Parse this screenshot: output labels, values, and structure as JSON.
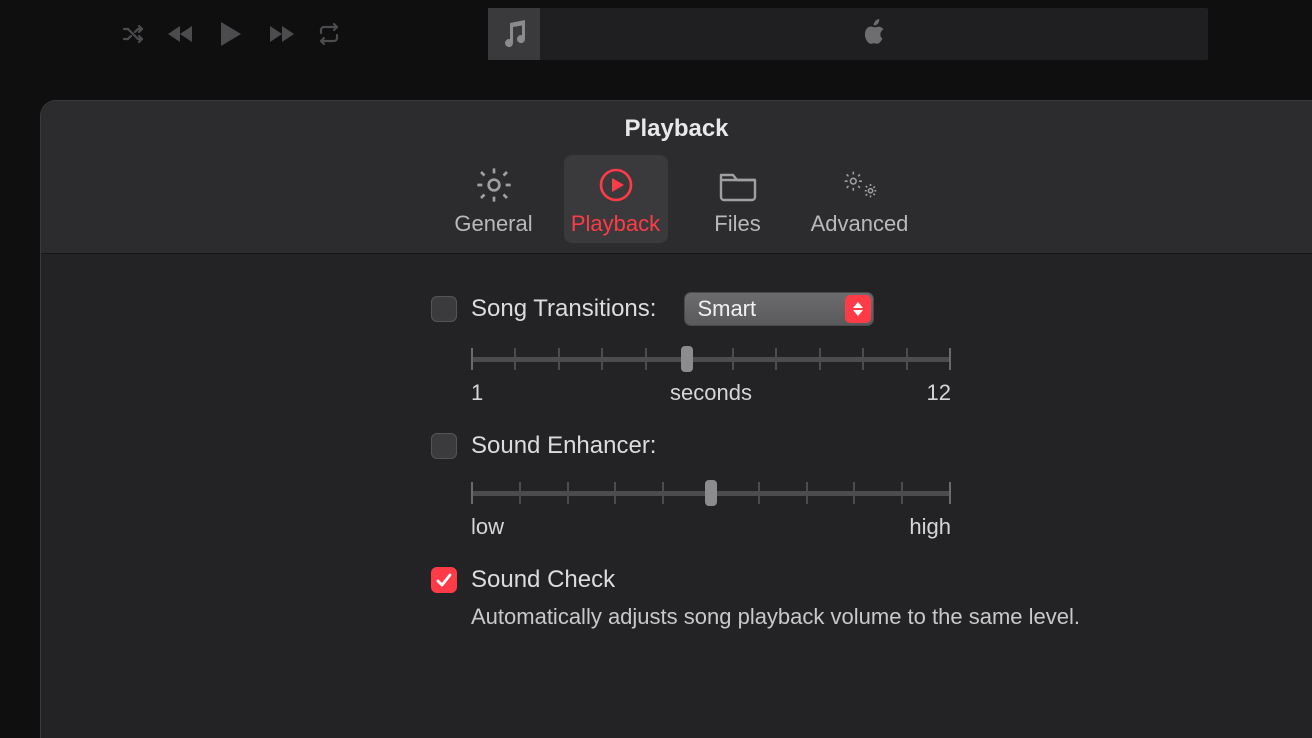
{
  "player": {
    "icons": {
      "shuffle": "shuffle-icon",
      "prev": "previous-icon",
      "play": "play-icon",
      "next": "next-icon",
      "repeat": "repeat-icon",
      "music": "music-note-icon",
      "apple": "apple-logo-icon"
    }
  },
  "panel": {
    "title": "Playback",
    "tabs": [
      {
        "id": "general",
        "label": "General",
        "icon": "gear-icon",
        "active": false
      },
      {
        "id": "playback",
        "label": "Playback",
        "icon": "play-circle-icon",
        "active": true
      },
      {
        "id": "files",
        "label": "Files",
        "icon": "folder-icon",
        "active": false
      },
      {
        "id": "advanced",
        "label": "Advanced",
        "icon": "gears-icon",
        "active": false
      }
    ]
  },
  "settings": {
    "song_transitions": {
      "label": "Song Transitions:",
      "checked": false,
      "popup_value": "Smart",
      "slider": {
        "min_label": "1",
        "mid_label": "seconds",
        "max_label": "12",
        "position_pct": 45,
        "ticks": 12
      }
    },
    "sound_enhancer": {
      "label": "Sound Enhancer:",
      "checked": false,
      "slider": {
        "min_label": "low",
        "mid_label": "",
        "max_label": "high",
        "position_pct": 50,
        "ticks": 11
      }
    },
    "sound_check": {
      "label": "Sound Check",
      "checked": true,
      "description": "Automatically adjusts song playback volume to the same level."
    }
  },
  "colors": {
    "accent": "#ff3b47"
  }
}
